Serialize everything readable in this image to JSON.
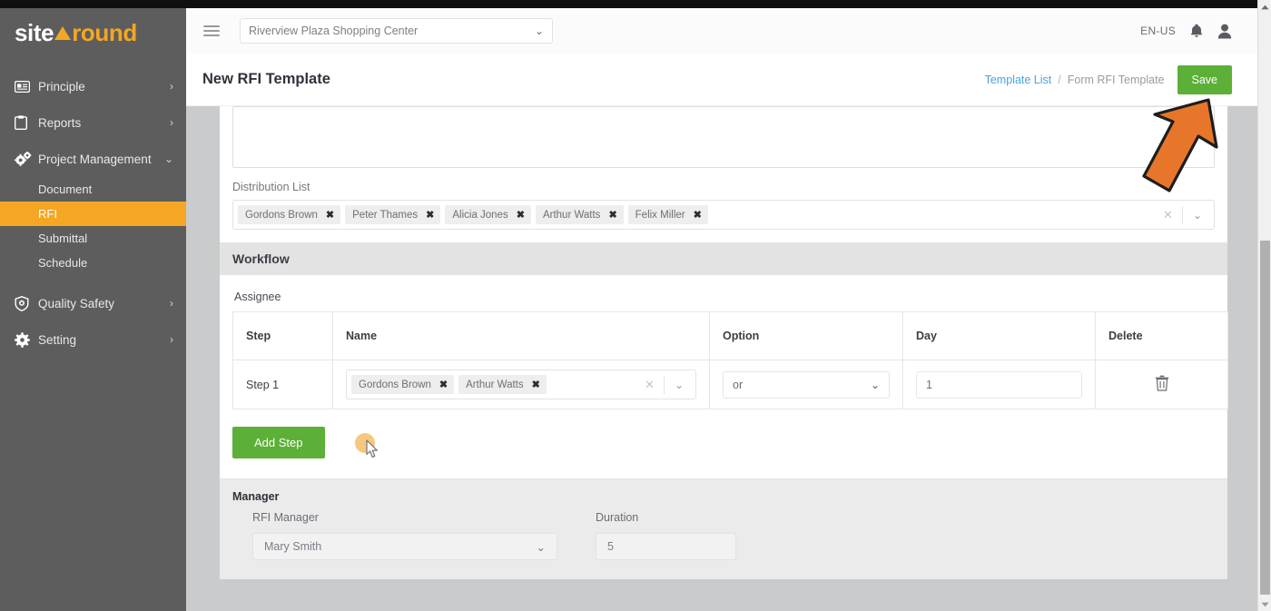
{
  "brand": {
    "name_white": "site",
    "name_orange": "round"
  },
  "sidebar": {
    "items": [
      {
        "label": "Principle",
        "icon": "id-card-icon",
        "chevron": "›"
      },
      {
        "label": "Reports",
        "icon": "clipboard-icon",
        "chevron": "›"
      },
      {
        "label": "Project Management",
        "icon": "gears-icon",
        "chevron": "⌄"
      },
      {
        "label": "Quality Safety",
        "icon": "shield-icon",
        "chevron": "›"
      },
      {
        "label": "Setting",
        "icon": "gear-icon",
        "chevron": "›"
      }
    ],
    "subitems": [
      {
        "label": "Document",
        "active": false
      },
      {
        "label": "RFI",
        "active": true
      },
      {
        "label": "Submittal",
        "active": false
      },
      {
        "label": "Schedule",
        "active": false
      }
    ],
    "active_color": "#f5a623"
  },
  "topbar": {
    "menu_icon": "hamburger-icon",
    "project_selected": "Riverview Plaza Shopping Center",
    "project_chevron": "⌄",
    "language": "EN-US",
    "bell_icon": "bell-icon",
    "user_icon": "user-avatar-icon"
  },
  "subheader": {
    "title": "New RFI Template",
    "breadcrumb_link": "Template List",
    "breadcrumb_separator": "/",
    "breadcrumb_current": "Form RFI Template",
    "save_label": "Save",
    "save_color": "#5cb037"
  },
  "form": {
    "distribution_label": "Distribution List",
    "distribution_chips": [
      "Gordons Brown",
      "Peter Thames",
      "Alicia Jones",
      "Arthur Watts",
      "Felix Miller"
    ],
    "chip_remove": "✖",
    "clear_icon": "✕",
    "dropdown_icon": "⌄"
  },
  "workflow": {
    "section_title": "Workflow",
    "assignee_label": "Assignee",
    "columns": [
      "Step",
      "Name",
      "Option",
      "Day",
      "Delete"
    ],
    "rows": [
      {
        "step": "Step 1",
        "names": [
          "Gordons Brown",
          "Arthur Watts"
        ],
        "option": "or",
        "day": "1",
        "delete_icon": "trash-icon"
      }
    ],
    "add_step_label": "Add Step",
    "add_step_color": "#5cb037"
  },
  "manager": {
    "section_title": "Manager",
    "rfi_manager_label": "RFI Manager",
    "rfi_manager_value": "Mary Smith",
    "duration_label": "Duration",
    "duration_value": "5"
  },
  "annotation": {
    "arrow_color": "#e8762a",
    "points_to": "save-button"
  }
}
